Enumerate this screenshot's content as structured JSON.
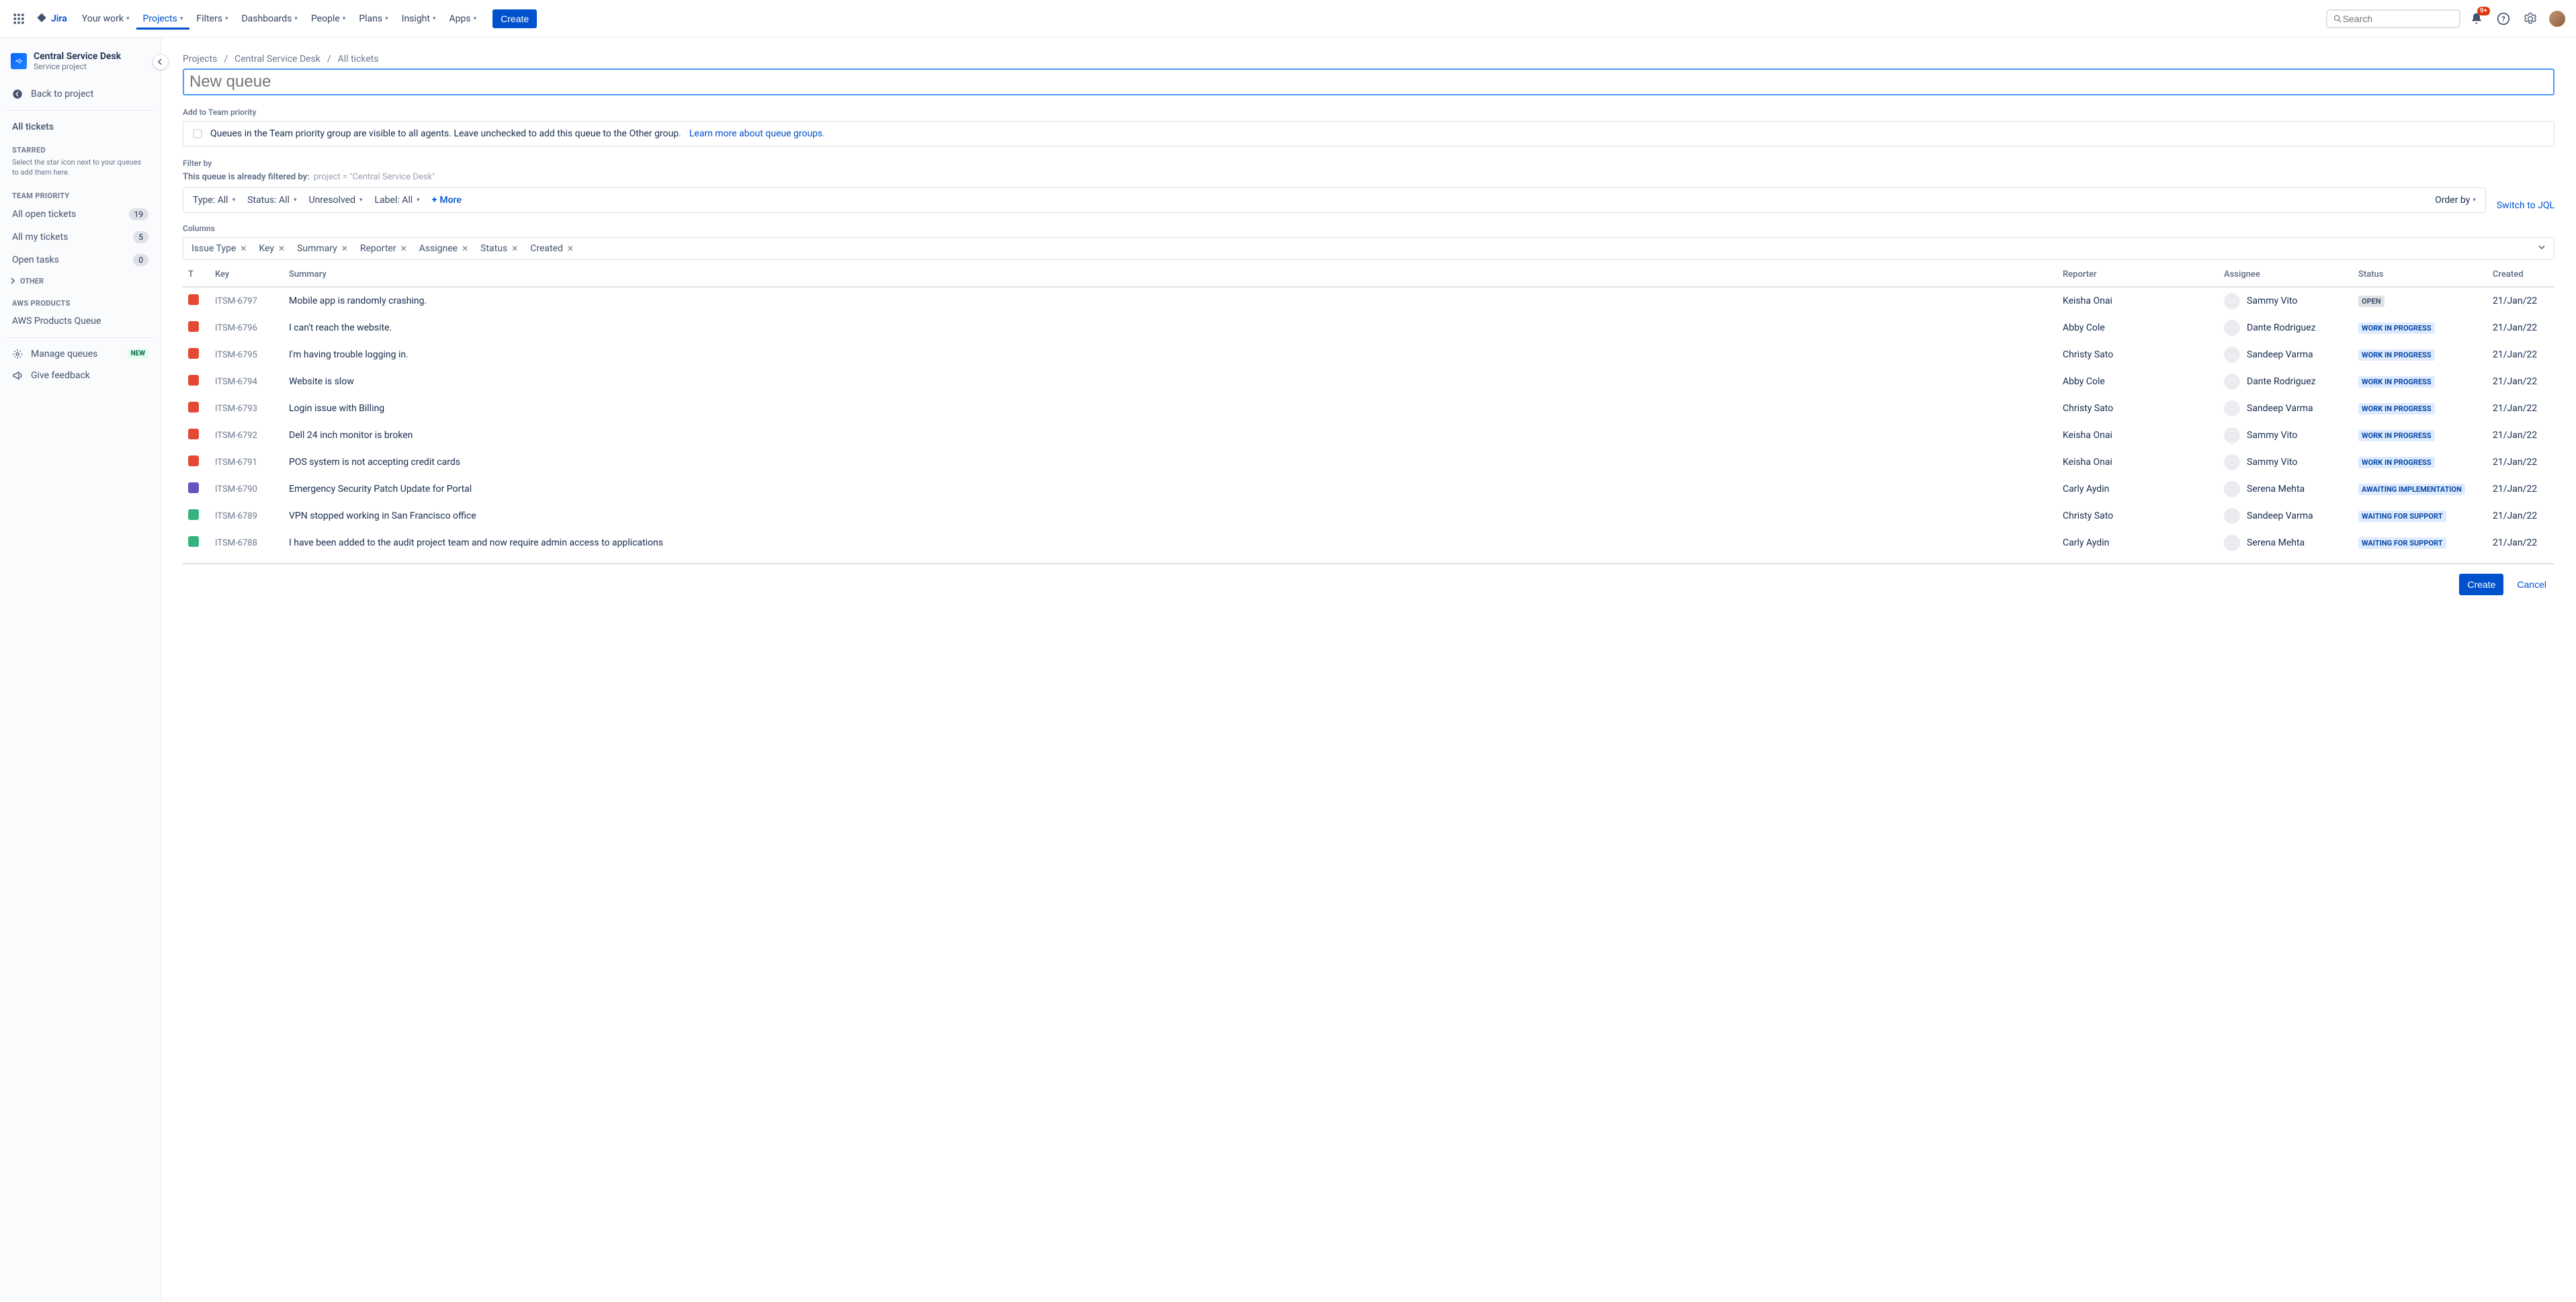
{
  "nav": {
    "logo_text": "Jira",
    "items": [
      "Your work",
      "Projects",
      "Filters",
      "Dashboards",
      "People",
      "Plans",
      "Insight",
      "Apps"
    ],
    "active_index": 1,
    "create_label": "Create",
    "search_placeholder": "Search",
    "notification_badge": "9+"
  },
  "sidebar": {
    "project_name": "Central Service Desk",
    "project_type": "Service project",
    "back_label": "Back to project",
    "all_tickets_label": "All tickets",
    "starred_label": "STARRED",
    "starred_hint": "Select the star icon next to your queues to add them here.",
    "team_priority_label": "TEAM PRIORITY",
    "queues": [
      {
        "label": "All open tickets",
        "count": "19"
      },
      {
        "label": "All my tickets",
        "count": "5"
      },
      {
        "label": "Open tasks",
        "count": "0"
      }
    ],
    "other_label": "OTHER",
    "aws_label": "AWS PRODUCTS",
    "aws_queue": "AWS Products Queue",
    "manage_queues_label": "Manage queues",
    "new_badge": "NEW",
    "feedback_label": "Give feedback"
  },
  "main": {
    "breadcrumb": [
      "Projects",
      "Central Service Desk",
      "All tickets"
    ],
    "title_placeholder": "New queue",
    "add_team_label": "Add to Team priority",
    "team_info": "Queues in the Team priority group are visible to all agents. Leave unchecked to add this queue to the Other group.",
    "learn_more": "Learn more about queue groups.",
    "filter_by_label": "Filter by",
    "filter_prefix": "This queue is already filtered by:",
    "filter_jql": "project = \"Central Service Desk\"",
    "filters": {
      "type": "Type: All",
      "status": "Status: All",
      "unresolved": "Unresolved",
      "label": "Label: All",
      "more": "More",
      "order_by": "Order by",
      "switch_jql": "Switch to JQL"
    },
    "columns_label": "Columns",
    "columns": [
      "Issue Type",
      "Key",
      "Summary",
      "Reporter",
      "Assignee",
      "Status",
      "Created"
    ],
    "headers": {
      "t": "T",
      "key": "Key",
      "summary": "Summary",
      "reporter": "Reporter",
      "assignee": "Assignee",
      "status": "Status",
      "created": "Created"
    },
    "rows": [
      {
        "type": "red",
        "key": "ITSM-6797",
        "summary": "Mobile app is randomly crashing.",
        "reporter": "Keisha Onai",
        "assignee": "Sammy Vito",
        "status": "OPEN",
        "status_cls": "st-open",
        "created": "21/Jan/22"
      },
      {
        "type": "red",
        "key": "ITSM-6796",
        "summary": "I can't reach the website.",
        "reporter": "Abby Cole",
        "assignee": "Dante Rodriguez",
        "status": "WORK IN PROGRESS",
        "status_cls": "st-blue",
        "created": "21/Jan/22"
      },
      {
        "type": "red",
        "key": "ITSM-6795",
        "summary": "I'm having trouble logging in.",
        "reporter": "Christy Sato",
        "assignee": "Sandeep Varma",
        "status": "WORK IN PROGRESS",
        "status_cls": "st-blue",
        "created": "21/Jan/22"
      },
      {
        "type": "red",
        "key": "ITSM-6794",
        "summary": "Website is slow",
        "reporter": "Abby Cole",
        "assignee": "Dante Rodriguez",
        "status": "WORK IN PROGRESS",
        "status_cls": "st-blue",
        "created": "21/Jan/22"
      },
      {
        "type": "red",
        "key": "ITSM-6793",
        "summary": "Login issue with Billing",
        "reporter": "Christy Sato",
        "assignee": "Sandeep Varma",
        "status": "WORK IN PROGRESS",
        "status_cls": "st-blue",
        "created": "21/Jan/22"
      },
      {
        "type": "red",
        "key": "ITSM-6792",
        "summary": "Dell 24 inch monitor is broken",
        "reporter": "Keisha Onai",
        "assignee": "Sammy Vito",
        "status": "WORK IN PROGRESS",
        "status_cls": "st-blue",
        "created": "21/Jan/22"
      },
      {
        "type": "red",
        "key": "ITSM-6791",
        "summary": "POS system is not accepting credit cards",
        "reporter": "Keisha Onai",
        "assignee": "Sammy Vito",
        "status": "WORK IN PROGRESS",
        "status_cls": "st-blue",
        "created": "21/Jan/22"
      },
      {
        "type": "purple",
        "key": "ITSM-6790",
        "summary": "Emergency Security Patch Update for Portal",
        "reporter": "Carly Aydin",
        "assignee": "Serena Mehta",
        "status": "AWAITING IMPLEMENTATION",
        "status_cls": "st-blue",
        "created": "21/Jan/22"
      },
      {
        "type": "green",
        "key": "ITSM-6789",
        "summary": "VPN stopped working in San Francisco office",
        "reporter": "Christy Sato",
        "assignee": "Sandeep Varma",
        "status": "WAITING FOR SUPPORT",
        "status_cls": "st-blue",
        "created": "21/Jan/22"
      },
      {
        "type": "green",
        "key": "ITSM-6788",
        "summary": "I have been added to the audit project team and now require admin access to applications",
        "reporter": "Carly Aydin",
        "assignee": "Serena Mehta",
        "status": "WAITING FOR SUPPORT",
        "status_cls": "st-blue",
        "created": "21/Jan/22"
      }
    ],
    "footer": {
      "create": "Create",
      "cancel": "Cancel"
    }
  }
}
